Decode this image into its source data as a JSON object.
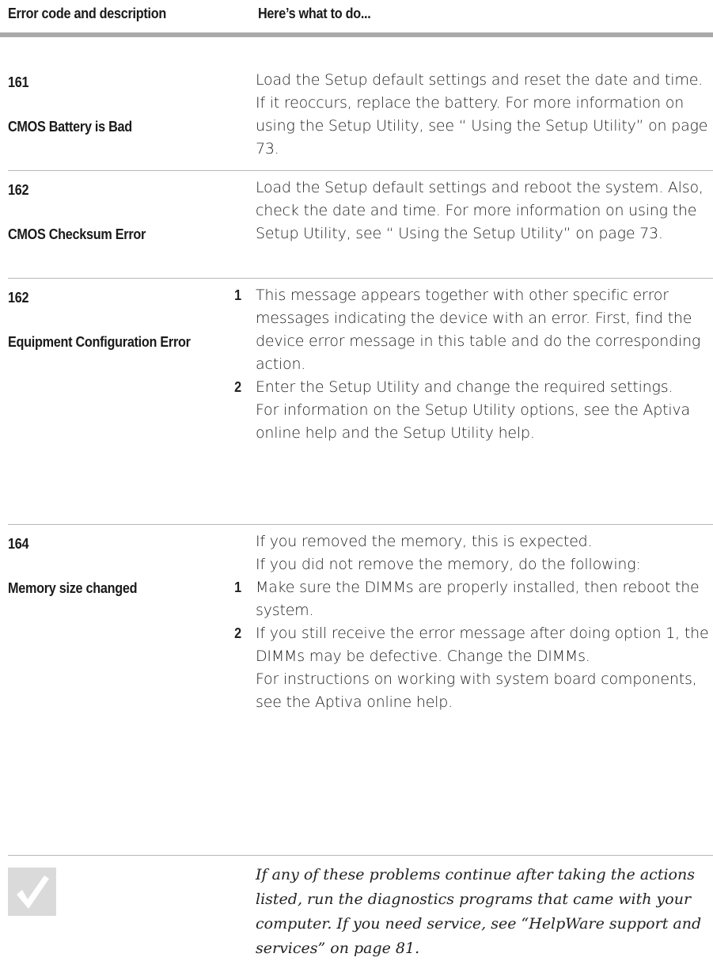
{
  "header": {
    "col1": "Error code and description",
    "col2": "Here’s what to do..."
  },
  "rows": [
    {
      "code": "161",
      "desc": "CMOS Battery is Bad",
      "text": "Load the Setup default settings and reset the date and time. If it reoccurs, replace the battery. For more information on using the Setup Utility, see “ Using the Setup Utility” on page 73."
    },
    {
      "code": "162",
      "desc": "CMOS Checksum Error",
      "text": "Load the Setup default settings and reboot the system. Also, check the date and time. For more information on using the Setup Utility, see “ Using the Setup Utility” on page 73."
    },
    {
      "code": "162",
      "desc": "Equipment Configuration Error",
      "steps": [
        {
          "num": "1",
          "text": "This message appears together with other specific error messages indicating the device with an error. First, find the device error message in this table and do the corresponding action."
        },
        {
          "num": "2",
          "text": "Enter the Setup Utility and change the required settings."
        }
      ],
      "trailing": "For information on the Setup Utility options, see the Aptiva online help and the Setup Utility help."
    },
    {
      "code": "164",
      "desc": "Memory size changed",
      "intro1": "If you removed the memory, this is expected.",
      "intro2": "If you did not remove the memory, do the following:",
      "steps": [
        {
          "num": "1",
          "text": "Make sure the DIMMs are properly installed, then reboot the system."
        },
        {
          "num": "2",
          "text": "If you still receive the error message after doing option 1, the DIMMs may be defective. Change the DIMMs."
        }
      ],
      "trailing": "For instructions on working with system board components, see the Aptiva online help."
    }
  ],
  "note": {
    "icon": "checkmark-icon",
    "text": "If any of these problems continue after taking the actions listed, run the diagnostics programs that came with your computer. If you need service, see “HelpWare support and services” on page 81."
  }
}
